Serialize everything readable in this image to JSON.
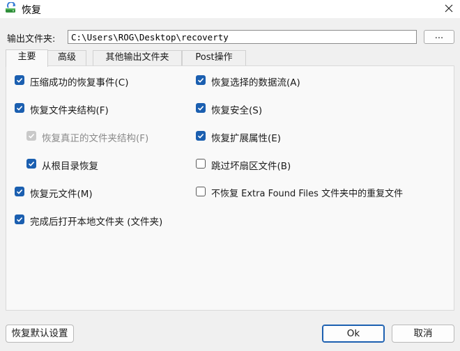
{
  "window": {
    "title": "恢复",
    "app_icon": "recovery-drive-icon",
    "close_icon": "close-icon"
  },
  "output_folder": {
    "label": "输出文件夹:",
    "value": "C:\\Users\\ROG\\Desktop\\recoverty",
    "browse_label": "..."
  },
  "tabs": [
    {
      "label": "主要",
      "active": true
    },
    {
      "label": "高级",
      "active": false
    },
    {
      "label": "其他输出文件夹",
      "active": false
    },
    {
      "label": "Post操作",
      "active": false
    }
  ],
  "options": {
    "compress_success": {
      "label": "压缩成功的恢复事件(C)",
      "checked": true,
      "enabled": true
    },
    "restore_folder_structure": {
      "label": "恢复文件夹结构(F)",
      "checked": true,
      "enabled": true
    },
    "restore_real_folder_structure": {
      "label": "恢复真正的文件夹结构(F)",
      "checked": true,
      "enabled": false
    },
    "restore_from_root": {
      "label": "从根目录恢复",
      "checked": true,
      "enabled": true
    },
    "restore_metafiles": {
      "label": "恢复元文件(M)",
      "checked": true,
      "enabled": true
    },
    "open_local_folder": {
      "label": "完成后打开本地文件夹 (文件夹)",
      "checked": true,
      "enabled": true
    },
    "restore_selected_streams": {
      "label": "恢复选择的数据流(A)",
      "checked": true,
      "enabled": true
    },
    "restore_security": {
      "label": "恢复安全(S)",
      "checked": true,
      "enabled": true
    },
    "restore_extended_attributes": {
      "label": "恢复扩展属性(E)",
      "checked": true,
      "enabled": true
    },
    "skip_bad_sectors": {
      "label": "跳过坏扇区文件(B)",
      "checked": false,
      "enabled": true
    },
    "skip_extra_found_duplicates": {
      "label": "不恢复 Extra Found Files 文件夹中的重复文件",
      "checked": false,
      "enabled": true
    }
  },
  "buttons": {
    "restore_defaults": "恢复默认设置",
    "ok": "Ok",
    "cancel": "取消"
  },
  "colors": {
    "accent": "#1b5fb0",
    "disabled_check": "#c9c9c9"
  }
}
